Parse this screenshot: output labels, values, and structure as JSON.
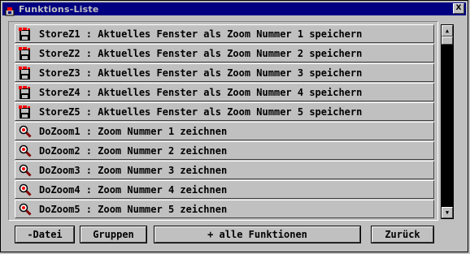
{
  "window": {
    "title": "Funktions-Liste",
    "close_label": "X"
  },
  "list": {
    "items": [
      {
        "icon": "save-floppy-icon",
        "label": "StoreZ1 : Aktuelles Fenster als Zoom Nummer 1 speichern"
      },
      {
        "icon": "save-floppy-icon",
        "label": "StoreZ2 : Aktuelles Fenster als Zoom Nummer 2 speichern"
      },
      {
        "icon": "save-floppy-icon",
        "label": "StoreZ3 : Aktuelles Fenster als Zoom Nummer 3 speichern"
      },
      {
        "icon": "save-floppy-icon",
        "label": "StoreZ4 : Aktuelles Fenster als Zoom Nummer 4 speichern"
      },
      {
        "icon": "save-floppy-icon",
        "label": "StoreZ5 : Aktuelles Fenster als Zoom Nummer 5 speichern"
      },
      {
        "icon": "magnifier-icon",
        "label": "DoZoom1 : Zoom Nummer 1 zeichnen"
      },
      {
        "icon": "magnifier-icon",
        "label": "DoZoom2 : Zoom Nummer 2 zeichnen"
      },
      {
        "icon": "magnifier-icon",
        "label": "DoZoom3 : Zoom Nummer 3 zeichnen"
      },
      {
        "icon": "magnifier-icon",
        "label": "DoZoom4 : Zoom Nummer 4 zeichnen"
      },
      {
        "icon": "magnifier-icon",
        "label": "DoZoom5 : Zoom Nummer 5 zeichnen"
      }
    ]
  },
  "buttons": {
    "datei": "-Datei",
    "gruppen": "Gruppen",
    "alle": "+ alle Funktionen",
    "zurueck": "Zurück"
  },
  "colors": {
    "titlebar": "#000080",
    "face": "#c0c0c0",
    "scroll_track": "#000000"
  }
}
